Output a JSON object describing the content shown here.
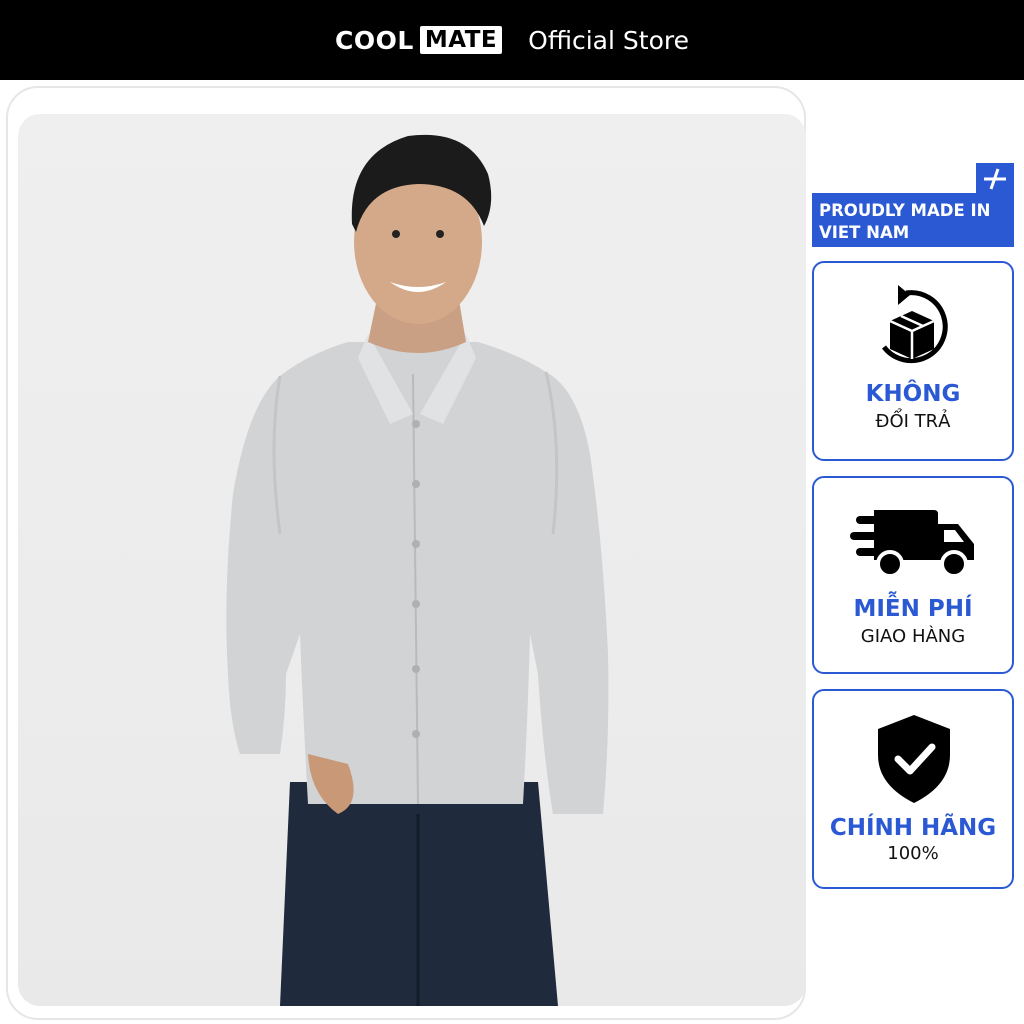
{
  "header": {
    "brand_cool": "COOL",
    "brand_mate": "MATE",
    "store_label": "Official Store",
    "background": "#000000"
  },
  "product": {
    "image": "man-in-grey-long-sleeve-shirt-photo"
  },
  "badges": {
    "made_in": {
      "line1": "PROUDLY MADE IN",
      "line2": "VIET NAM",
      "icon": "plus-slash-logo-icon",
      "color": "#2b59d4"
    },
    "items": [
      {
        "title": "KHÔNG",
        "subtitle": "ĐỔI TRẢ",
        "icon": "return-box-icon"
      },
      {
        "title": "MIỄN PHÍ",
        "subtitle": "GIAO HÀNG",
        "icon": "delivery-truck-icon"
      },
      {
        "title": "CHÍNH HÃNG",
        "subtitle": "100%",
        "icon": "shield-check-icon"
      }
    ]
  }
}
